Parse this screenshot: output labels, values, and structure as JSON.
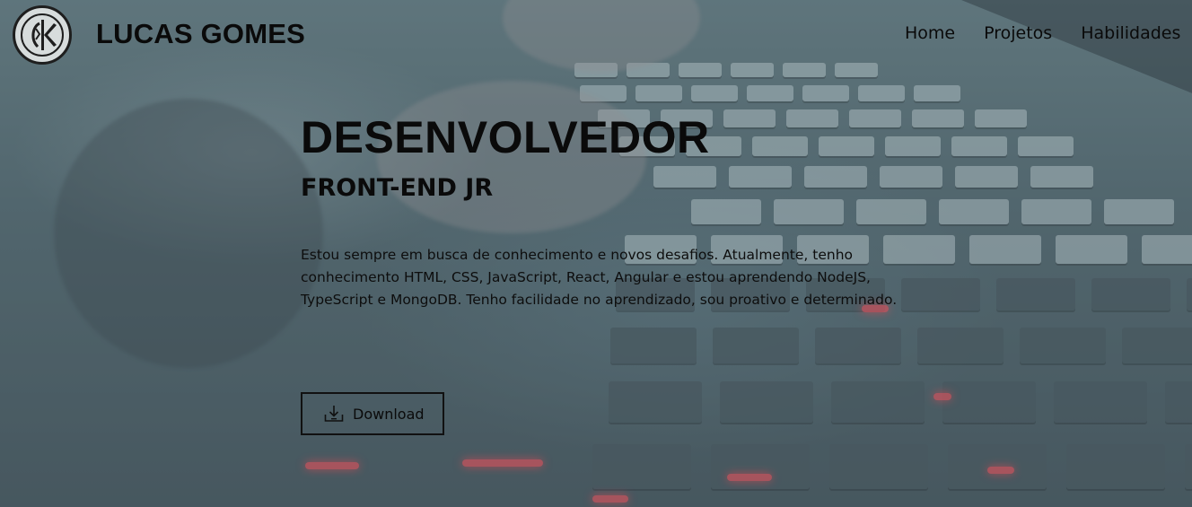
{
  "header": {
    "brand": "LUCAS GOMES",
    "logo_icon": "sith-empire-emblem-icon",
    "nav": [
      {
        "label": "Home"
      },
      {
        "label": "Projetos"
      },
      {
        "label": "Habilidades"
      }
    ]
  },
  "hero": {
    "title": "DESENVOLVEDOR",
    "subtitle": "FRONT-END JR",
    "description": "Estou sempre em busca de conhecimento e novos desafios. Atualmente, tenho conhecimento HTML, CSS, JavaScript, React, Angular e estou aprendendo NodeJS, TypeScript e MongoDB. Tenho facilidade no aprendizado, sou proativo e determinado.",
    "download_label": "Download",
    "download_icon": "download-icon"
  },
  "colors": {
    "text": "#0a0a0a",
    "background_tint": "#4b636a",
    "key_glow": "#ff4650"
  }
}
